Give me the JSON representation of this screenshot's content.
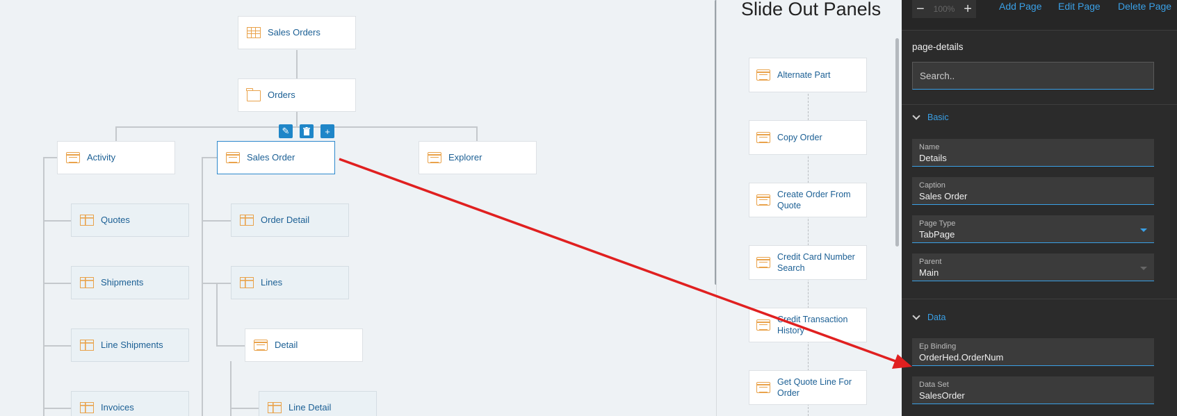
{
  "tree": {
    "root": "Sales Orders",
    "level1": "Orders",
    "toolbar": {
      "edit": "✎",
      "delete": "🗑",
      "add": "+"
    },
    "branches": {
      "activity": "Activity",
      "sales_order": "Sales Order",
      "explorer": "Explorer"
    },
    "activity_children": [
      "Quotes",
      "Shipments",
      "Line Shipments",
      "Invoices"
    ],
    "sales_order_children": [
      "Order Detail",
      "Lines",
      "Detail",
      "Line Detail"
    ]
  },
  "slide_out": {
    "title": "Slide Out Panels",
    "items": [
      "Alternate Part",
      "Copy Order",
      "Create Order From Quote",
      "Credit Card Number Search",
      "Credit Transaction History",
      "Get Quote Line For Order"
    ]
  },
  "panel": {
    "zoom_minus": "−",
    "zoom_value": "100%",
    "zoom_plus": "+",
    "add_page": "Add Page",
    "edit_page": "Edit Page",
    "delete_page": "Delete Page",
    "title": "page-details",
    "search_placeholder": "Search..",
    "basic_section": "Basic",
    "data_section": "Data",
    "fields": {
      "name_label": "Name",
      "name_value": "Details",
      "caption_label": "Caption",
      "caption_value": "Sales Order",
      "page_type_label": "Page Type",
      "page_type_value": "TabPage",
      "parent_label": "Parent",
      "parent_value": "Main",
      "ep_binding_label": "Ep Binding",
      "ep_binding_value": "OrderHed.OrderNum",
      "data_set_label": "Data Set",
      "data_set_value": "SalesOrder"
    }
  },
  "colors": {
    "accent": "#1f86c8",
    "link": "#3aa0e6",
    "icon": "#e9a24a",
    "arrow": "#e02020"
  }
}
